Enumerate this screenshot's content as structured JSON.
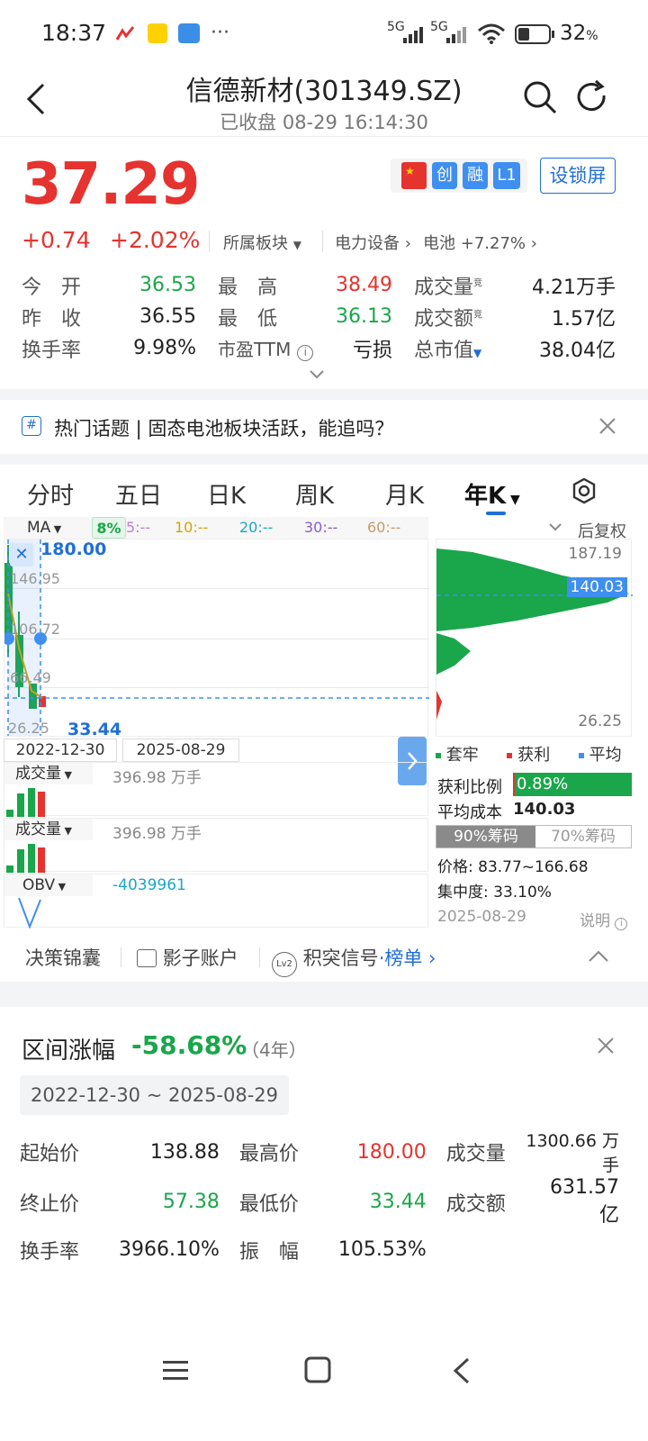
{
  "status": {
    "time": "18:37",
    "more": "···",
    "network1": "5G",
    "network2": "5G",
    "battery": "32",
    "battery_unit": "%"
  },
  "header": {
    "title": "信德新材(301349.SZ)",
    "subtitle": "已收盘 08-29 16:14:30",
    "lock_button": "设锁屏",
    "tags": [
      "创",
      "融",
      "L1"
    ]
  },
  "price": {
    "last": "37.29",
    "change": "+0.74",
    "change_pct": "+2.02%",
    "sector_label": "所属板块",
    "sector1": "电力设备",
    "sector2": "电池",
    "sector2_pct": "+7.27%"
  },
  "quote": {
    "rows": [
      [
        {
          "k": "今　开",
          "v": "36.53",
          "c": "green"
        },
        {
          "k": "最　高",
          "v": "38.49",
          "c": "red"
        },
        {
          "k": "成交量",
          "sup": "竞",
          "v": "4.21万手",
          "c": "dark"
        }
      ],
      [
        {
          "k": "昨　收",
          "v": "36.55",
          "c": "dark"
        },
        {
          "k": "最　低",
          "v": "36.13",
          "c": "green"
        },
        {
          "k": "成交额",
          "sup": "竞",
          "v": "1.57亿",
          "c": "dark"
        }
      ],
      [
        {
          "k": "换手率",
          "v": "9.98%",
          "c": "dark"
        },
        {
          "k": "市盈TTM",
          "v": "亏损",
          "c": "dark"
        },
        {
          "k": "总市值",
          "v": "38.04亿",
          "c": "dark"
        }
      ]
    ]
  },
  "topic": {
    "text": "热门话题 | 固态电池板块活跃，能追吗？"
  },
  "tabs": [
    "分时",
    "五日",
    "日K",
    "周K",
    "月K",
    "年K"
  ],
  "chart": {
    "ma_label": "MA",
    "ma_badge": "8%",
    "ma5": "5:--",
    "ma10": "10:--",
    "ma20": "20:--",
    "ma30": "30:--",
    "ma60": "60:--",
    "adj": "后复权",
    "y_labels": [
      "187.19",
      "146.95",
      "106.72",
      "66.49",
      "26.25"
    ],
    "high_label": "180.00",
    "low_label": "33.44",
    "date_start": "2022-12-30",
    "date_end": "2025-08-29",
    "vol1_label": "成交量",
    "vol1_value": "396.98 万手",
    "vol2_label": "成交量",
    "vol2_value": "396.98 万手",
    "obv_label": "OBV",
    "obv_value": "-4039961",
    "chip_top": "187.19",
    "chip_mid": "140.03",
    "chip_bottom": "26.25",
    "legend": [
      "套牢",
      "获利",
      "平均"
    ],
    "profit_ratio_label": "获利比例",
    "profit_ratio": "0.89%",
    "avg_cost_label": "平均成本",
    "avg_cost": "140.03",
    "chip90": "90%筹码",
    "chip70": "70%筹码",
    "price_range": "价格: 83.77~166.68",
    "concentration": "集中度: 33.10%",
    "chip_date": "2025-08-29",
    "explain": "说明"
  },
  "bottom_tools": {
    "t1": "决策锦囊",
    "t2": "影子账户",
    "t3_badge": "Lv2",
    "t3": "积突信号",
    "t3_dot": "·",
    "t3_link": "榜单"
  },
  "range": {
    "title": "区间涨幅",
    "pct": "-58.68%",
    "years": "（4年）",
    "date_range": "2022-12-30 ~ 2025-08-29",
    "rows": [
      [
        {
          "k": "起始价",
          "v": "138.88",
          "c": "dark"
        },
        {
          "k": "最高价",
          "v": "180.00",
          "c": "red"
        },
        {
          "k": "成交量",
          "v": "1300.66 万手",
          "c": "dark"
        }
      ],
      [
        {
          "k": "终止价",
          "v": "57.38",
          "c": "green"
        },
        {
          "k": "最低价",
          "v": "33.44",
          "c": "green"
        },
        {
          "k": "成交额",
          "v": "631.57 亿",
          "c": "dark"
        }
      ],
      [
        {
          "k": "换手率",
          "v": "3966.10%",
          "c": "dark"
        },
        {
          "k": "振　幅",
          "v": "105.53%",
          "c": "dark"
        }
      ]
    ]
  },
  "colors": {
    "up": "#e5332f",
    "down": "#1aa64a",
    "accent": "#1f6fd6"
  }
}
